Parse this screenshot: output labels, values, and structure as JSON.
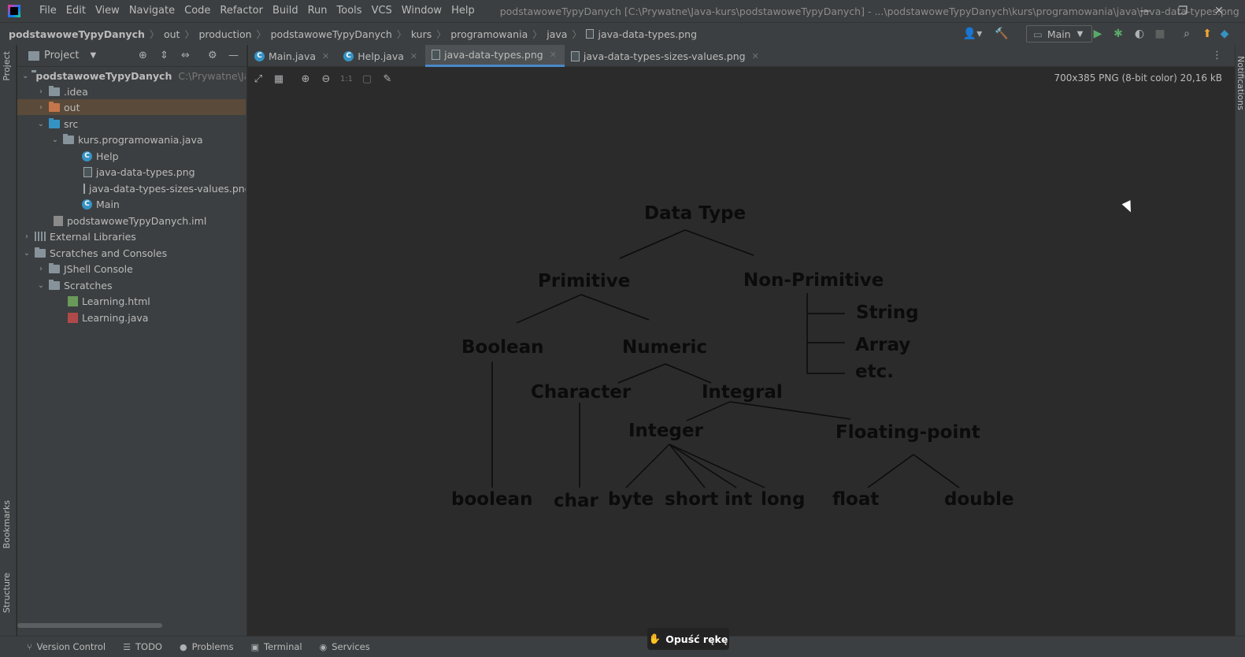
{
  "window": {
    "title": "podstawoweTypyDanych [C:\\Prywatne\\Java-kurs\\podstawoweTypyDanych] - ...\\podstawoweTypyDanych\\kurs\\programowania\\java\\java-data-types.png",
    "minimize": "—",
    "restore": "❐",
    "close": "✕"
  },
  "menu": [
    "File",
    "Edit",
    "View",
    "Navigate",
    "Code",
    "Refactor",
    "Build",
    "Run",
    "Tools",
    "VCS",
    "Window",
    "Help"
  ],
  "breadcrumbs": [
    "podstawoweTypyDanych",
    "out",
    "production",
    "podstawoweTypyDanych",
    "kurs",
    "programowania",
    "java",
    "java-data-types.png"
  ],
  "toolbar": {
    "run_config": "Main"
  },
  "left_stripe": {
    "project": "Project",
    "bookmarks": "Bookmarks",
    "structure": "Structure"
  },
  "right_stripe": {
    "notifications": "Notifications"
  },
  "project_panel": {
    "title": "Project",
    "tree": [
      {
        "label": "podstawoweTypyDanych",
        "hint": "C:\\Prywatne\\Java-",
        "icon": "module-folder-icon",
        "expanded": true
      },
      {
        "label": ".idea",
        "icon": "folder-icon"
      },
      {
        "label": "out",
        "icon": "excluded-folder-icon"
      },
      {
        "label": "src",
        "icon": "source-folder-icon"
      },
      {
        "label": "kurs.programowania.java",
        "icon": "package-icon"
      },
      {
        "label": "Help",
        "icon": "class-icon"
      },
      {
        "label": "java-data-types.png",
        "icon": "image-file-icon"
      },
      {
        "label": "java-data-types-sizes-values.png",
        "icon": "image-file-icon"
      },
      {
        "label": "Main",
        "icon": "class-icon"
      },
      {
        "label": "podstawoweTypyDanych.iml",
        "icon": "iml-file-icon"
      },
      {
        "label": "External Libraries",
        "icon": "library-icon"
      },
      {
        "label": "Scratches and Consoles",
        "icon": "scratches-icon"
      },
      {
        "label": "JShell Console",
        "icon": "folder-icon"
      },
      {
        "label": "Scratches",
        "icon": "folder-icon"
      },
      {
        "label": "Learning.html",
        "icon": "html-file-icon"
      },
      {
        "label": "Learning.java",
        "icon": "java-scratch-icon"
      }
    ]
  },
  "tabs": [
    {
      "label": "Main.java",
      "active": false
    },
    {
      "label": "Help.java",
      "active": false
    },
    {
      "label": "java-data-types.png",
      "active": true
    },
    {
      "label": "java-data-types-sizes-values.png",
      "active": false
    }
  ],
  "viewer": {
    "info": "700x385 PNG (8-bit color) 20,16 kB"
  },
  "diagram": {
    "root": "Data Type",
    "primitive": "Primitive",
    "non_primitive": "Non-Primitive",
    "string": "String",
    "array": "Array",
    "etc": "etc.",
    "boolean_cat": "Boolean",
    "numeric": "Numeric",
    "character": "Character",
    "integral": "Integral",
    "integer": "Integer",
    "floating_point": "Floating-point",
    "t_boolean": "boolean",
    "t_char": "char",
    "t_byte": "byte",
    "t_short": "short",
    "t_int": "int",
    "t_long": "long",
    "t_float": "float",
    "t_double": "double"
  },
  "statusbar": {
    "version_control": "Version Control",
    "todo": "TODO",
    "problems": "Problems",
    "terminal": "Terminal",
    "services": "Services"
  },
  "hand_button": "Opuść rękę"
}
